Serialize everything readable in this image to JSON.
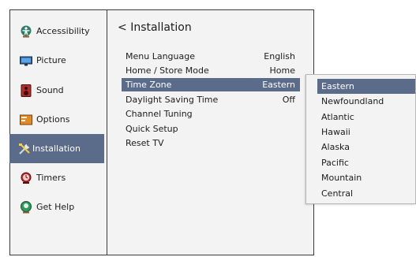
{
  "sidebar": {
    "items": [
      {
        "label": "Accessibility",
        "icon": "accessibility-icon"
      },
      {
        "label": "Picture",
        "icon": "picture-icon"
      },
      {
        "label": "Sound",
        "icon": "sound-icon"
      },
      {
        "label": "Options",
        "icon": "options-icon"
      },
      {
        "label": "Installation",
        "icon": "installation-icon",
        "active": true
      },
      {
        "label": "Timers",
        "icon": "timers-icon"
      },
      {
        "label": "Get Help",
        "icon": "help-icon"
      }
    ]
  },
  "main": {
    "title": "Installation",
    "back_glyph": "<",
    "rows": [
      {
        "label": "Menu Language",
        "value": "English"
      },
      {
        "label": "Home / Store Mode",
        "value": "Home"
      },
      {
        "label": "Time Zone",
        "value": "Eastern",
        "selected": true
      },
      {
        "label": "Daylight Saving Time",
        "value": "Off"
      },
      {
        "label": "Channel Tuning",
        "value": ""
      },
      {
        "label": "Quick Setup",
        "value": ""
      },
      {
        "label": "Reset TV",
        "value": ""
      }
    ]
  },
  "timezone_dropdown": {
    "options": [
      "Eastern",
      "Newfoundland",
      "Atlantic",
      "Hawaii",
      "Alaska",
      "Pacific",
      "Mountain",
      "Central"
    ],
    "selected": "Eastern"
  },
  "colors": {
    "highlight": "#5b6b8a",
    "panel": "#f3f3f3",
    "border": "#3a3a3a",
    "text": "#1c1c1c"
  }
}
